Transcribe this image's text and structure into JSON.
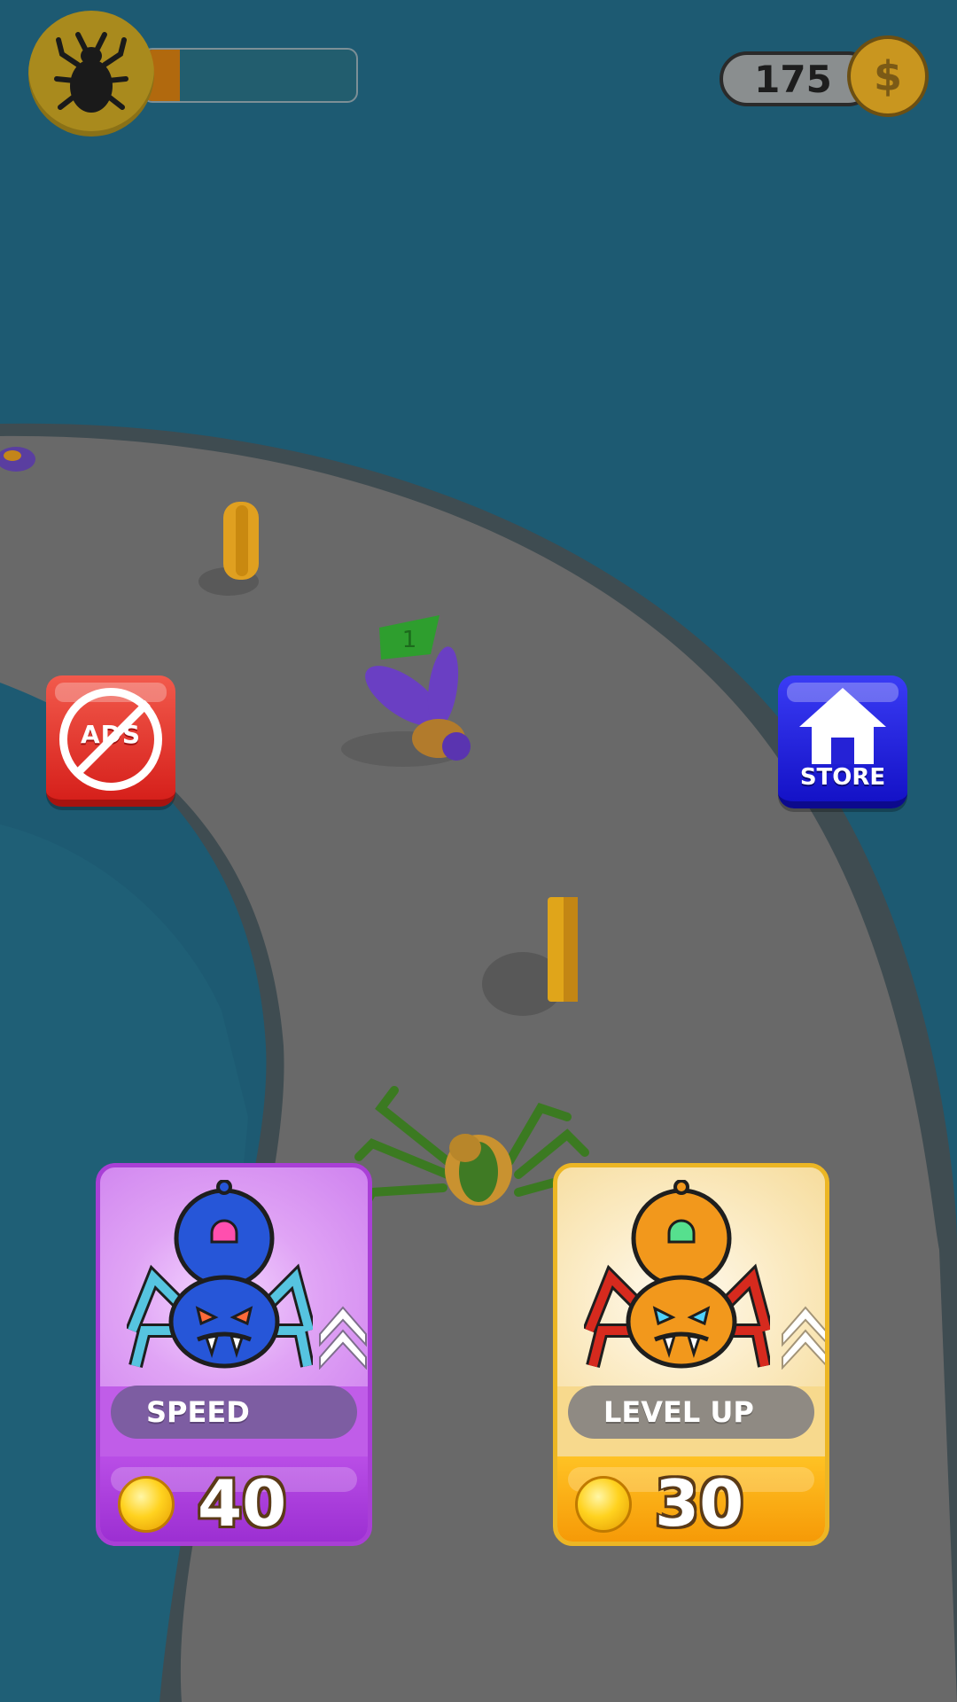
{
  "hud": {
    "level_icon": "beetle-icon",
    "progress_fraction": 0.17,
    "coins": "175",
    "coin_icon_symbol": "$"
  },
  "side_buttons": {
    "no_ads_label": "ADS",
    "store_label": "STORE"
  },
  "scene": {
    "enemy_level_badge": "1"
  },
  "upgrades": [
    {
      "label": "SPEED",
      "price": "40",
      "icon": "blue-spider-icon"
    },
    {
      "label": "LEVEL UP",
      "price": "30",
      "icon": "orange-spider-icon"
    }
  ],
  "colors": {
    "water": "#1d5a72",
    "track": "#696969",
    "track_edge": "#3f4c51",
    "no_ads_red": "#d6201b",
    "store_blue": "#1412c7",
    "speed_purple": "#c05de8",
    "level_orange": "#f69a07",
    "coin_gold": "#ffd21f"
  }
}
